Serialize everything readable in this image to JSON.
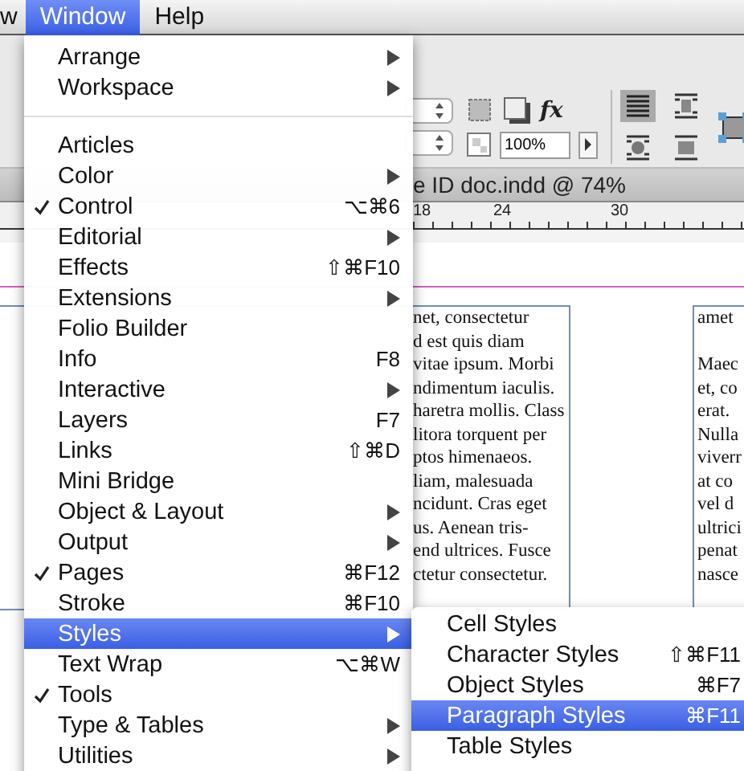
{
  "menubar": [
    {
      "label": "w",
      "selected": false
    },
    {
      "label": "Window",
      "selected": true
    },
    {
      "label": "Help",
      "selected": false
    }
  ],
  "toolbar": {
    "opacity_field": "100%",
    "fx": "fx"
  },
  "document": {
    "title": "e ID doc.indd @ 74%",
    "ruler": [
      "18",
      "24",
      "30"
    ],
    "column_1": [
      "net, consectetur",
      "d est quis diam",
      "vitae ipsum. Morbi",
      "ndimentum iaculis.",
      "haretra mollis. Class",
      "litora torquent per",
      "ptos himenaeos.",
      "liam, malesuada",
      "ncidunt. Cras eget",
      "us. Aenean tris-",
      "end ultrices. Fusce",
      "ctetur consectetur."
    ],
    "column_2": [
      [
        "amet"
      ],
      [
        "Maec",
        "et, co",
        "erat.",
        "Nulla",
        "viverr",
        "at co",
        "vel d",
        "ultrici",
        "penat",
        "nasce"
      ]
    ]
  },
  "window_menu": {
    "groups": [
      [
        {
          "label": "Arrange",
          "kind": "submenu",
          "checked": false,
          "selected": false
        },
        {
          "label": "Workspace",
          "kind": "submenu",
          "checked": false,
          "selected": false
        }
      ],
      [
        {
          "label": "Articles",
          "kind": "plain",
          "checked": false,
          "selected": false
        },
        {
          "label": "Color",
          "kind": "submenu",
          "checked": false,
          "selected": false
        },
        {
          "label": "Control",
          "kind": "shortcut",
          "shortcut": "⌥⌘6",
          "checked": true,
          "selected": false
        },
        {
          "label": "Editorial",
          "kind": "submenu",
          "checked": false,
          "selected": false
        },
        {
          "label": "Effects",
          "kind": "shortcut",
          "shortcut": "⇧⌘F10",
          "checked": false,
          "selected": false
        },
        {
          "label": "Extensions",
          "kind": "submenu",
          "checked": false,
          "selected": false
        },
        {
          "label": "Folio Builder",
          "kind": "plain",
          "checked": false,
          "selected": false
        },
        {
          "label": "Info",
          "kind": "shortcut",
          "shortcut": "F8",
          "checked": false,
          "selected": false
        },
        {
          "label": "Interactive",
          "kind": "submenu",
          "checked": false,
          "selected": false
        },
        {
          "label": "Layers",
          "kind": "shortcut",
          "shortcut": "F7",
          "checked": false,
          "selected": false
        },
        {
          "label": "Links",
          "kind": "shortcut",
          "shortcut": "⇧⌘D",
          "checked": false,
          "selected": false
        },
        {
          "label": "Mini Bridge",
          "kind": "plain",
          "checked": false,
          "selected": false
        },
        {
          "label": "Object & Layout",
          "kind": "submenu",
          "checked": false,
          "selected": false
        },
        {
          "label": "Output",
          "kind": "submenu",
          "checked": false,
          "selected": false
        },
        {
          "label": "Pages",
          "kind": "shortcut",
          "shortcut": "⌘F12",
          "checked": true,
          "selected": false
        },
        {
          "label": "Stroke",
          "kind": "shortcut",
          "shortcut": "⌘F10",
          "checked": false,
          "selected": false
        },
        {
          "label": "Styles",
          "kind": "submenu",
          "checked": false,
          "selected": true
        },
        {
          "label": "Text Wrap",
          "kind": "shortcut",
          "shortcut": "⌥⌘W",
          "checked": false,
          "selected": false
        },
        {
          "label": "Tools",
          "kind": "plain",
          "checked": true,
          "selected": false
        },
        {
          "label": "Type & Tables",
          "kind": "submenu",
          "checked": false,
          "selected": false
        },
        {
          "label": "Utilities",
          "kind": "submenu",
          "checked": false,
          "selected": false
        }
      ]
    ]
  },
  "styles_submenu": [
    {
      "label": "Cell Styles",
      "kind": "plain",
      "selected": false
    },
    {
      "label": "Character Styles",
      "kind": "shortcut",
      "shortcut": "⇧⌘F11",
      "selected": false
    },
    {
      "label": "Object Styles",
      "kind": "shortcut",
      "shortcut": "⌘F7",
      "selected": false
    },
    {
      "label": "Paragraph Styles",
      "kind": "shortcut",
      "shortcut": "⌘F11",
      "selected": true
    },
    {
      "label": "Table Styles",
      "kind": "plain",
      "selected": false
    }
  ]
}
